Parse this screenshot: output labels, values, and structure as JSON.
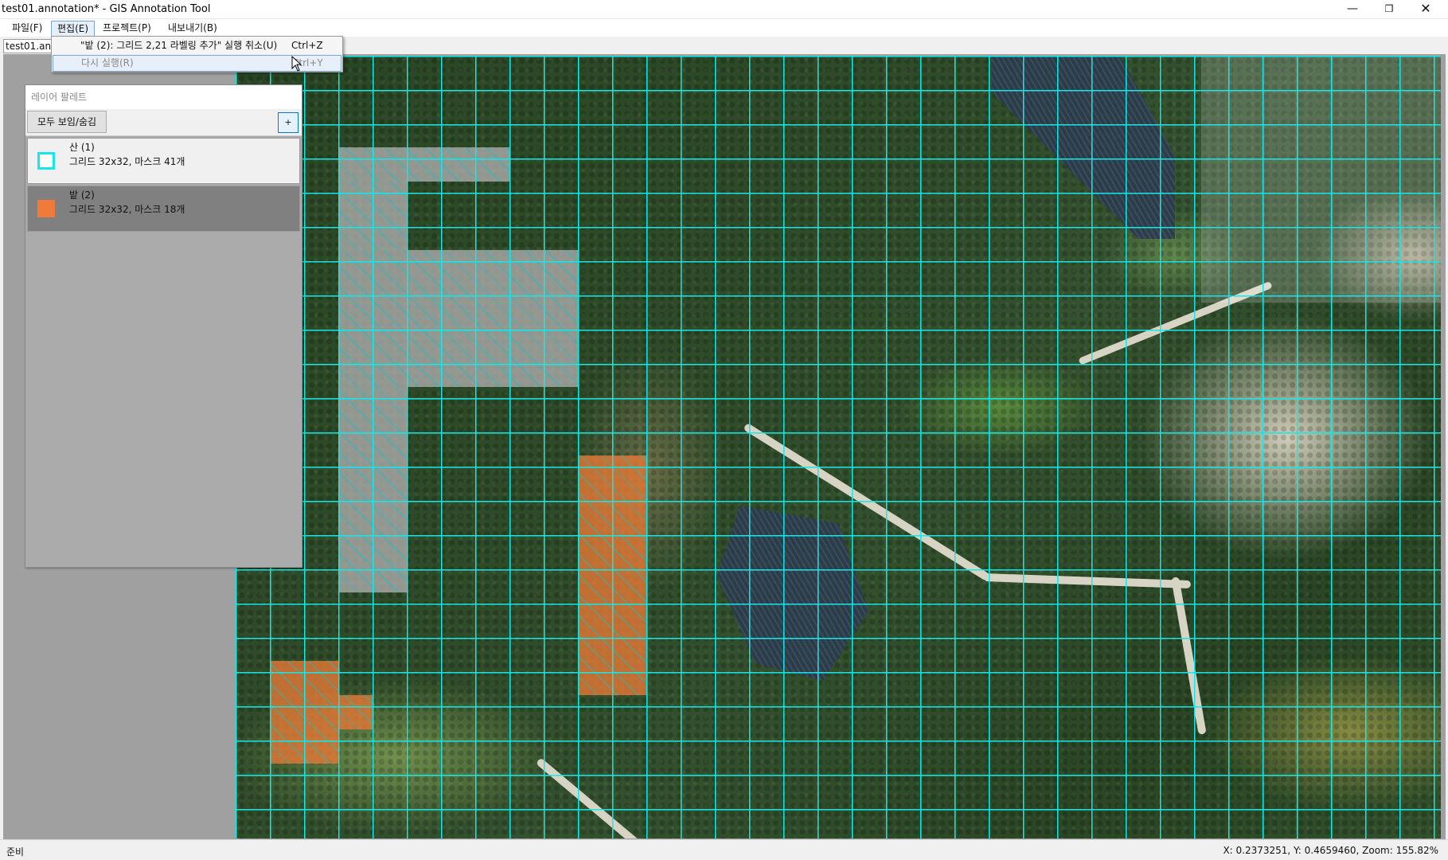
{
  "window": {
    "title": "test01.annotation* - GIS Annotation Tool",
    "min_glyph": "—",
    "max_glyph": "❐",
    "close_glyph": "✕"
  },
  "menu": {
    "file": "파일(F)",
    "edit": "편집(E)",
    "project": "프로젝트(P)",
    "export": "내보내기(B)"
  },
  "edit_menu": {
    "undo_label": "\"밭 (2): 그리드 2,21 라벨링 추가\" 실행 취소(U)",
    "undo_shortcut": "Ctrl+Z",
    "redo_label": "다시 실행(R)",
    "redo_shortcut": "Ctrl+Y"
  },
  "tab": {
    "label": "test01.annotation*"
  },
  "palette": {
    "title": "레이어 팔레트",
    "toggle_all": "모두 보임/숨김",
    "add": "+",
    "layers": [
      {
        "name": "산 (1)",
        "desc": "그리드 32x32, 마스크 41개",
        "color": "#14e8e8",
        "selected": false
      },
      {
        "name": "밭 (2)",
        "desc": "그리드 32x32, 마스크 18개",
        "color": "#f07a3a",
        "selected": true
      }
    ]
  },
  "map": {
    "grid_color": "#14e8e8"
  },
  "status": {
    "ready": "준비",
    "coords": "X: 0.2373251, Y: 0.4659460, Zoom: 155.82%"
  }
}
